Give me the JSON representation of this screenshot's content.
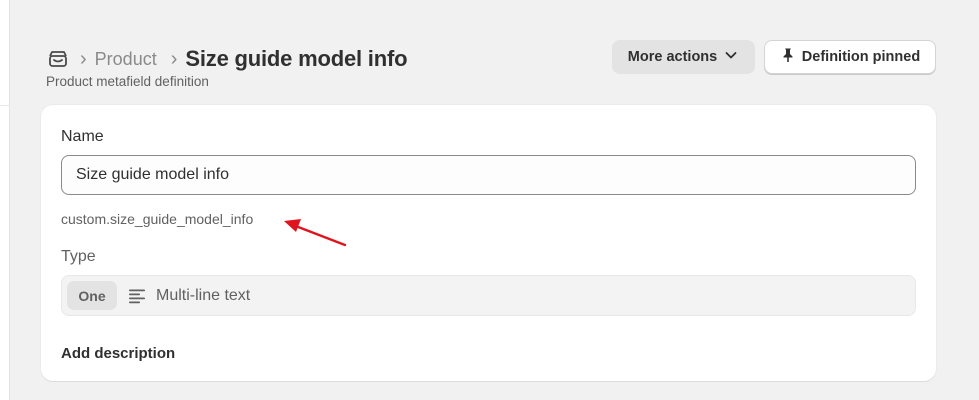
{
  "breadcrumb": {
    "parent_label": "Product",
    "separator": "›",
    "title": "Size guide model info",
    "store_icon": "store-icon"
  },
  "subtitle": "Product metafield definition",
  "actions": {
    "more_label": "More actions",
    "more_icon": "chevron-down-icon",
    "pinned_label": "Definition pinned",
    "pinned_icon": "pin-icon"
  },
  "form": {
    "name_label": "Name",
    "name_value": "Size guide model info",
    "namespace_key": "custom.size_guide_model_info",
    "type_label": "Type",
    "type_cardinality": "One",
    "type_icon": "text-lines-icon",
    "type_name": "Multi-line text",
    "add_description_label": "Add description"
  },
  "annotation": {
    "arrow_color": "#e0141e"
  },
  "colors": {
    "background": "#f1f1f1",
    "card": "#ffffff",
    "secondary_button": "#e3e3e3",
    "text": "#303030",
    "muted_text": "#616161"
  }
}
